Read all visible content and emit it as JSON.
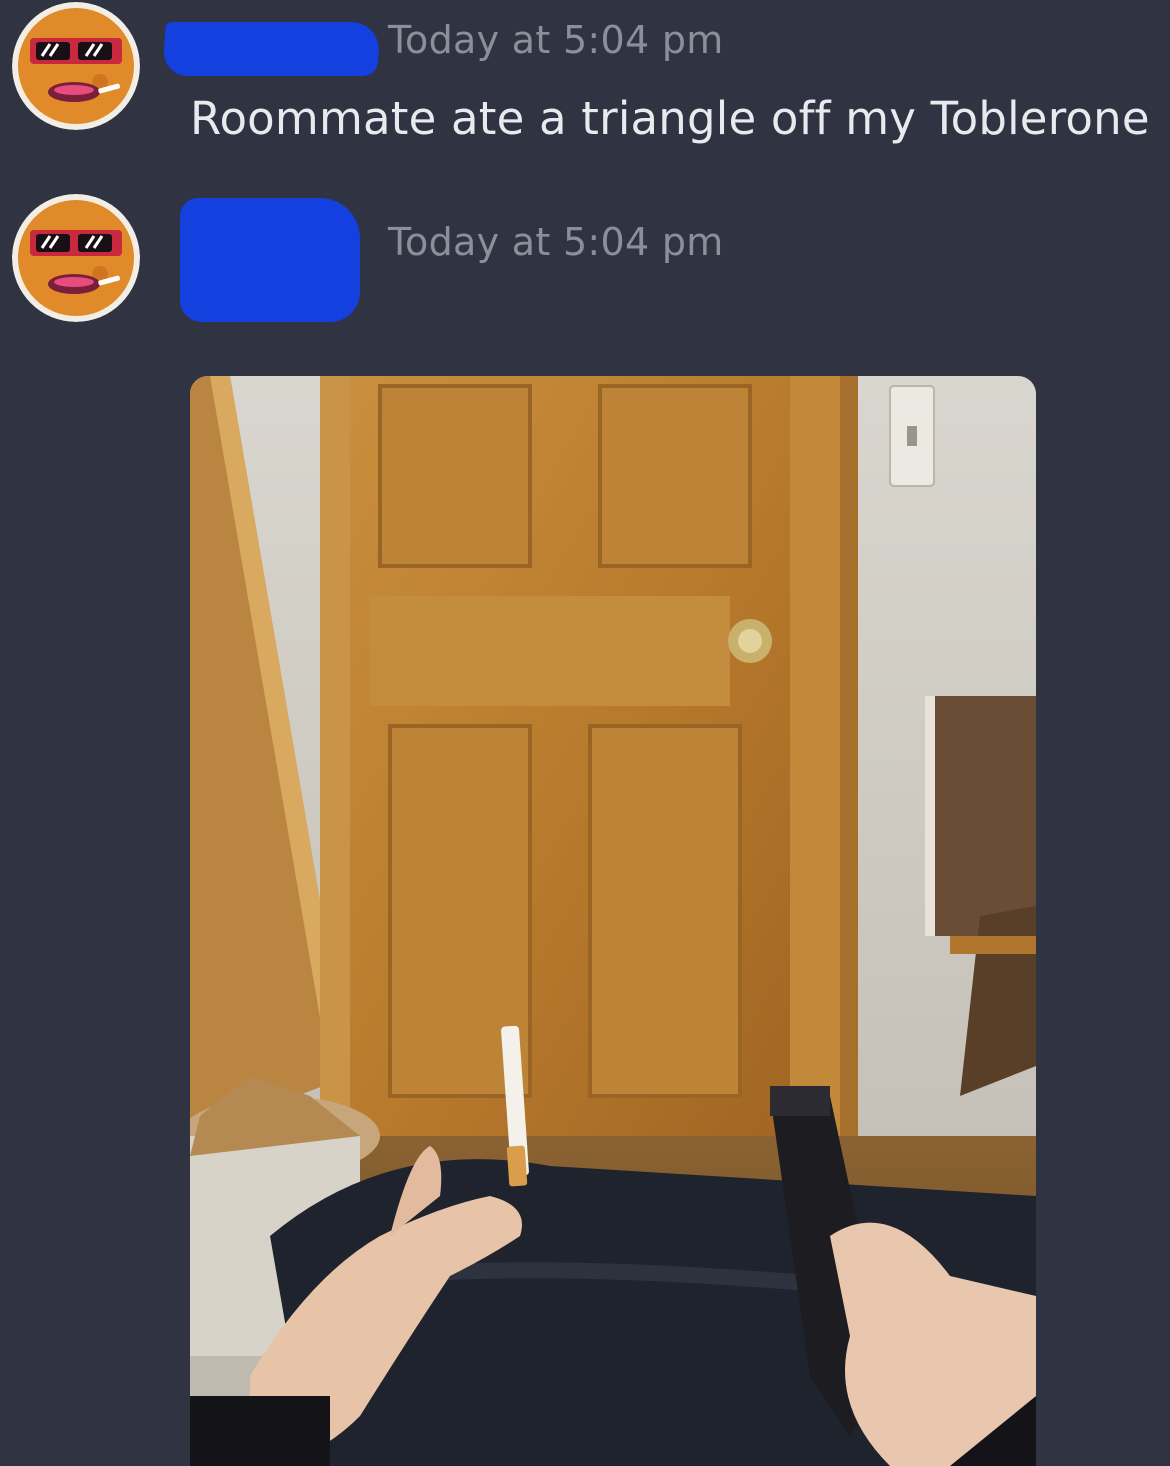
{
  "channel": {
    "messages": [
      {
        "author_avatar": "cartoon-nugget-avatar-with-sunglasses",
        "author_name_redacted": true,
        "timestamp": "Today at 5:04 pm",
        "text": "Roommate ate a triangle off my Toblerone"
      },
      {
        "author_avatar": "cartoon-nugget-avatar-with-sunglasses",
        "author_name_redacted": true,
        "timestamp": "Today at 5:04 pm",
        "attachment": {
          "kind": "photo"
        }
      }
    ]
  },
  "colors": {
    "background": "#2f3342",
    "timestamp": "#8b8f99",
    "message_text": "#e9eaee",
    "redaction": "#1540e0"
  }
}
